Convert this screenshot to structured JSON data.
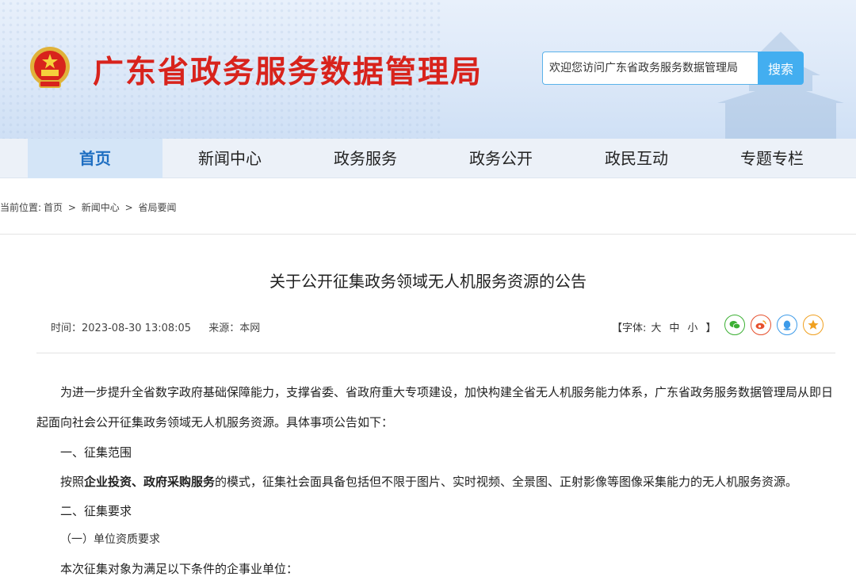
{
  "header": {
    "site_title": "广东省政务服务数据管理局",
    "search_placeholder": "欢迎您访问广东省政务服务数据管理局",
    "search_button": "搜索"
  },
  "nav": {
    "items": [
      "首页",
      "新闻中心",
      "政务服务",
      "政务公开",
      "政民互动",
      "专题专栏"
    ],
    "active_index": 0
  },
  "breadcrumb": {
    "prefix": "当前位置:",
    "home": "首页",
    "sep1": ">",
    "section": "新闻中心",
    "sep2": ">",
    "page": "省局要闻"
  },
  "article": {
    "title": "关于公开征集政务领域无人机服务资源的公告",
    "time_label": "时间：2023-08-30 13:08:05",
    "source_label": "来源：本网",
    "font_prefix": "【字体:",
    "font_large": "大",
    "font_medium": "中",
    "font_small": "小",
    "font_suffix": "】",
    "share_icons": [
      "wechat-icon",
      "weibo-icon",
      "qq-icon",
      "favorite-icon"
    ],
    "paragraph1": "为进一步提升全省数字政府基础保障能力，支撑省委、省政府重大专项建设，加快构建全省无人机服务能力体系，广东省政务服务数据管理局从即日起面向社会公开征集政务领域无人机服务资源。具体事项公告如下：",
    "heading1": "一、征集范围",
    "paragraph2_pre": "按照",
    "paragraph2_bold": "企业投资、政府采购服务",
    "paragraph2_post": "的模式，征集社会面具备包括但不限于图片、实时视频、全景图、正射影像等图像采集能力的无人机服务资源。",
    "heading2": "二、征集要求",
    "heading3": "（一）单位资质要求",
    "paragraph3": "本次征集对象为满足以下条件的企事业单位："
  },
  "colors": {
    "title_red": "#d8231c",
    "nav_active": "#1f6fc2",
    "search_blue": "#43aef0",
    "wechat": "#3cb034",
    "weibo": "#e6502d",
    "qq": "#3d9be9",
    "favorite": "#f0a020"
  }
}
